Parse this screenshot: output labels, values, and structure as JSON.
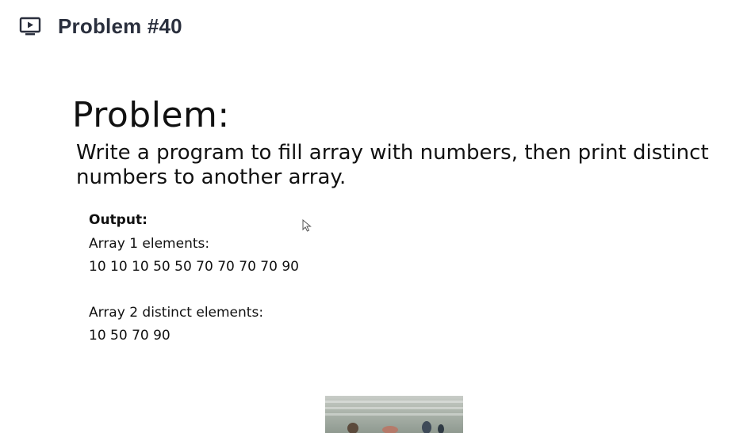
{
  "header": {
    "icon": "video-play-icon",
    "title": "Problem #40"
  },
  "slide": {
    "heading": "Problem:",
    "description": "Write a program to fill array with numbers, then print distinct numbers to another array.",
    "output_label": "Output:",
    "array1_label": "Array 1 elements:",
    "array1_values": "10 10 10 50 50 70 70 70 70 90",
    "array2_label": "Array 2 distinct elements:",
    "array2_values": "10 50 70 90"
  },
  "colors": {
    "title": "#2a2f3d",
    "text": "#111111"
  }
}
